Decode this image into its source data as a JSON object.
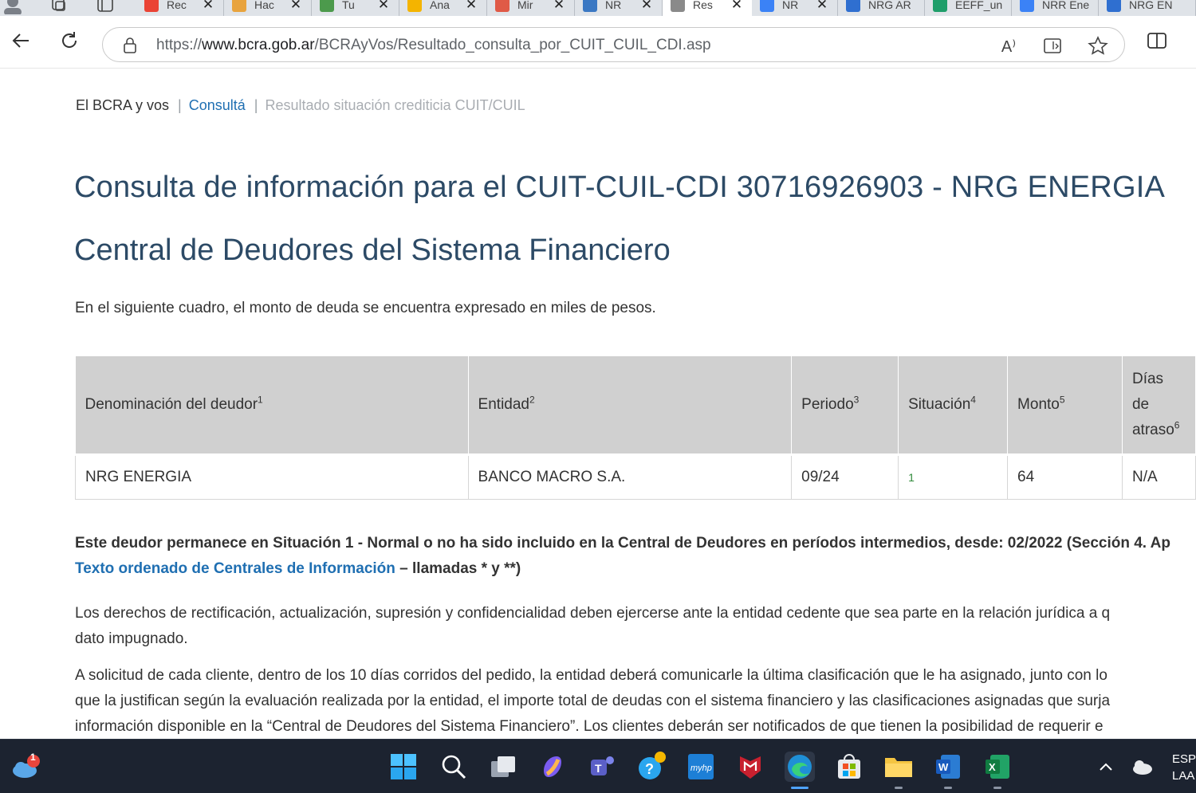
{
  "browser": {
    "tabs": [
      {
        "title": "Rec",
        "favicon": "gmail-icon",
        "color": "#ea4335"
      },
      {
        "title": "Hac",
        "favicon": "folder-icon",
        "color": "#e8a33d"
      },
      {
        "title": "Tu",
        "favicon": "globe-icon",
        "color": "#4c9a4c"
      },
      {
        "title": "Ana",
        "favicon": "analytics-icon",
        "color": "#f4b400"
      },
      {
        "title": "Mir",
        "favicon": "circle-icon",
        "color": "#e05a47"
      },
      {
        "title": "NR",
        "favicon": "linkedin-icon",
        "color": "#3a78c3"
      },
      {
        "title": "Res",
        "favicon": "bcra-icon",
        "color": "#8a8a8a",
        "active": true
      },
      {
        "title": "NR",
        "favicon": "search-icon",
        "color": "#3b82f6"
      },
      {
        "title": "NRG AR",
        "favicon": "copilot-icon",
        "color": "#2f6fd0"
      },
      {
        "title": "EEFF_un",
        "favicon": "sharepoint-icon",
        "color": "#1e9e6a"
      },
      {
        "title": "NRR Ene",
        "favicon": "search-icon",
        "color": "#3b82f6"
      },
      {
        "title": "NRG EN",
        "favicon": "copilot-icon",
        "color": "#2f6fd0"
      }
    ],
    "address": {
      "scheme": "https://",
      "host": "www.bcra.gob.ar",
      "path": "/BCRAyVos/Resultado_consulta_por_CUIT_CUIL_CDI.asp"
    },
    "read_aloud_label": "A⁾"
  },
  "breadcrumb": {
    "home": "El BCRA y vos",
    "sep": "|",
    "link": "Consultá",
    "current": "Resultado situación crediticia CUIT/CUIL"
  },
  "title": "Consulta de información para el CUIT-CUIL-CDI 30716926903 - NRG ENERGIA",
  "subtitle": "Central de Deudores del Sistema Financiero",
  "intro": "En el siguiente cuadro, el monto de deuda se encuentra expresado en miles de pesos.",
  "table": {
    "headers": [
      {
        "label": "Denominación del deudor",
        "sup": "1"
      },
      {
        "label": "Entidad",
        "sup": "2"
      },
      {
        "label": "Periodo",
        "sup": "3"
      },
      {
        "label": "Situación",
        "sup": "4"
      },
      {
        "label": "Monto",
        "sup": "5"
      },
      {
        "label_l1": "Días",
        "label_l2": "de",
        "label_l3": "atraso",
        "sup": "6"
      }
    ],
    "rows": [
      {
        "deudor": "NRG ENERGIA",
        "entidad": "BANCO MACRO S.A.",
        "periodo": "09/24",
        "situacion": "1",
        "monto": "64",
        "dias": "N/A"
      }
    ]
  },
  "note": {
    "line1": "Este deudor permanece en Situación 1 - Normal o no ha sido incluido en la Central de Deudores en períodos intermedios, desde: 02/2022 (Sección 4. Ap",
    "link": "Texto ordenado de Centrales de Información",
    "line2_rest": " – llamadas * y **)"
  },
  "paragraphs": {
    "p1_l1": "Los derechos de rectificación, actualización, supresión y confidencialidad deben ejercerse ante la entidad cedente que sea parte en la relación jurídica a q",
    "p1_l2": "dato impugnado.",
    "p2_l1": "A solicitud de cada cliente, dentro de los 10 días corridos del pedido, la entidad deberá comunicarle la última clasificación que le ha asignado, junto con lo",
    "p2_l2": "que la justifican según la evaluación realizada por la entidad, el importe total de deudas con el sistema financiero y las clasificaciones asignadas que surja",
    "p2_l3": "información disponible en la “Central de Deudores del Sistema Financiero”. Los clientes deberán ser notificados de que tienen la posibilidad de requerir e"
  },
  "taskbar": {
    "weather_badge": "1",
    "hp_label": "myhp",
    "word_label": "W",
    "excel_label": "X",
    "tray_lang_1": "ESP",
    "tray_lang_2": "LAA"
  }
}
